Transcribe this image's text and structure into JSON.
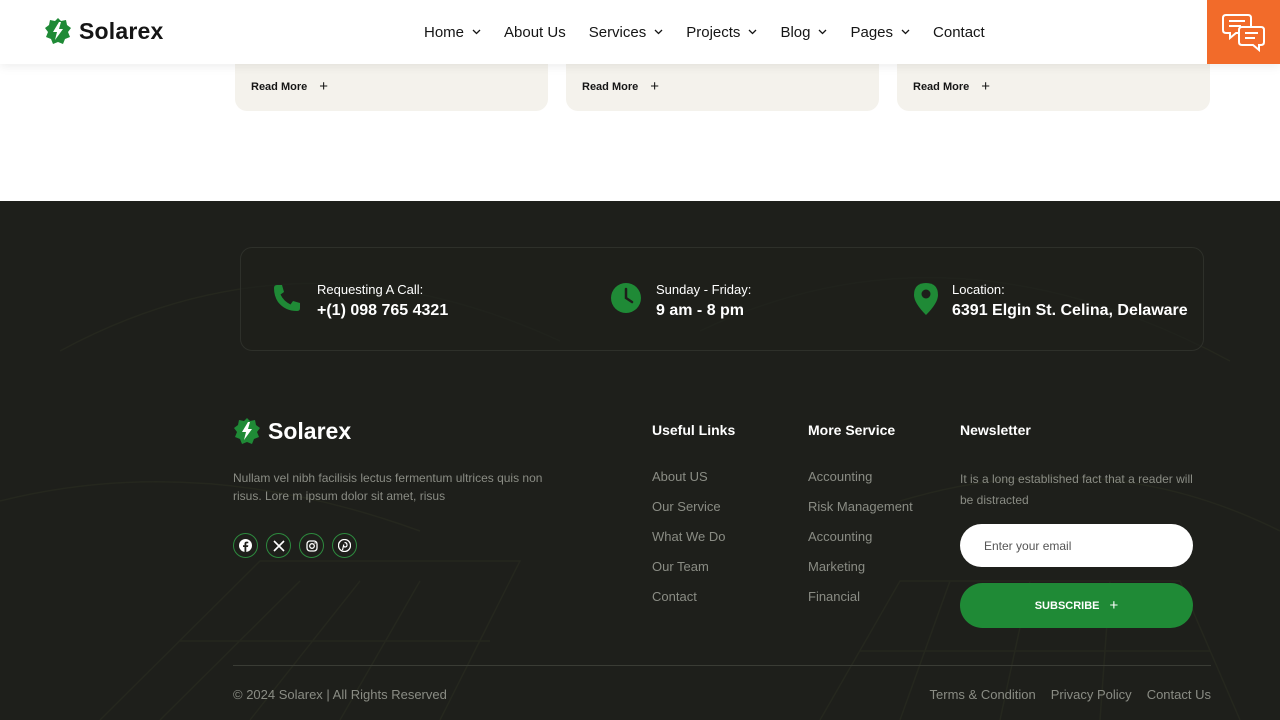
{
  "header": {
    "logo_text": "Solarex",
    "nav": [
      {
        "label": "Home",
        "has_dropdown": true
      },
      {
        "label": "About Us",
        "has_dropdown": false
      },
      {
        "label": "Services",
        "has_dropdown": true
      },
      {
        "label": "Projects",
        "has_dropdown": true
      },
      {
        "label": "Blog",
        "has_dropdown": true
      },
      {
        "label": "Pages",
        "has_dropdown": true
      },
      {
        "label": "Contact",
        "has_dropdown": false
      }
    ]
  },
  "cards": [
    {
      "read_more": "Read More"
    },
    {
      "read_more": "Read More"
    },
    {
      "read_more": "Read More"
    }
  ],
  "contact": {
    "call_label": "Requesting A Call:",
    "call_value": "+(1) 098 765 4321",
    "hours_label": "Sunday - Friday:",
    "hours_value": "9 am - 8 pm",
    "location_label": "Location:",
    "location_value": "6391 Elgin St. Celina, Delaware"
  },
  "footer": {
    "logo_text": "Solarex",
    "description": "Nullam vel nibh facilisis lectus fermentum ultrices quis non risus. Lore m ipsum dolor sit amet, risus",
    "useful_links_title": "Useful Links",
    "useful_links": [
      "About US",
      "Our Service",
      "What We Do",
      "Our Team",
      "Contact"
    ],
    "more_service_title": "More Service",
    "more_service": [
      "Accounting",
      "Risk Management",
      "Accounting",
      "Marketing",
      "Financial"
    ],
    "newsletter_title": "Newsletter",
    "newsletter_desc": "It is a long established fact that a reader will be distracted",
    "email_placeholder": "Enter your email",
    "subscribe_label": "SUBSCRIBE",
    "copyright": "© 2024 Solarex | All Rights Reserved",
    "legal_links": [
      "Terms & Condition",
      "Privacy Policy",
      "Contact Us"
    ]
  },
  "colors": {
    "brand_green": "#1f8a36",
    "accent_orange": "#f26b2a",
    "footer_bg": "#1e1f1b",
    "card_bg": "#f4f2ec"
  },
  "icons": {
    "logo": "lightning-leaf-icon",
    "chat": "chat-bubbles-icon",
    "call": "phone-icon",
    "hours": "clock-icon",
    "location": "map-pin-icon",
    "socials": [
      "facebook-icon",
      "x-icon",
      "instagram-icon",
      "pinterest-icon"
    ]
  }
}
